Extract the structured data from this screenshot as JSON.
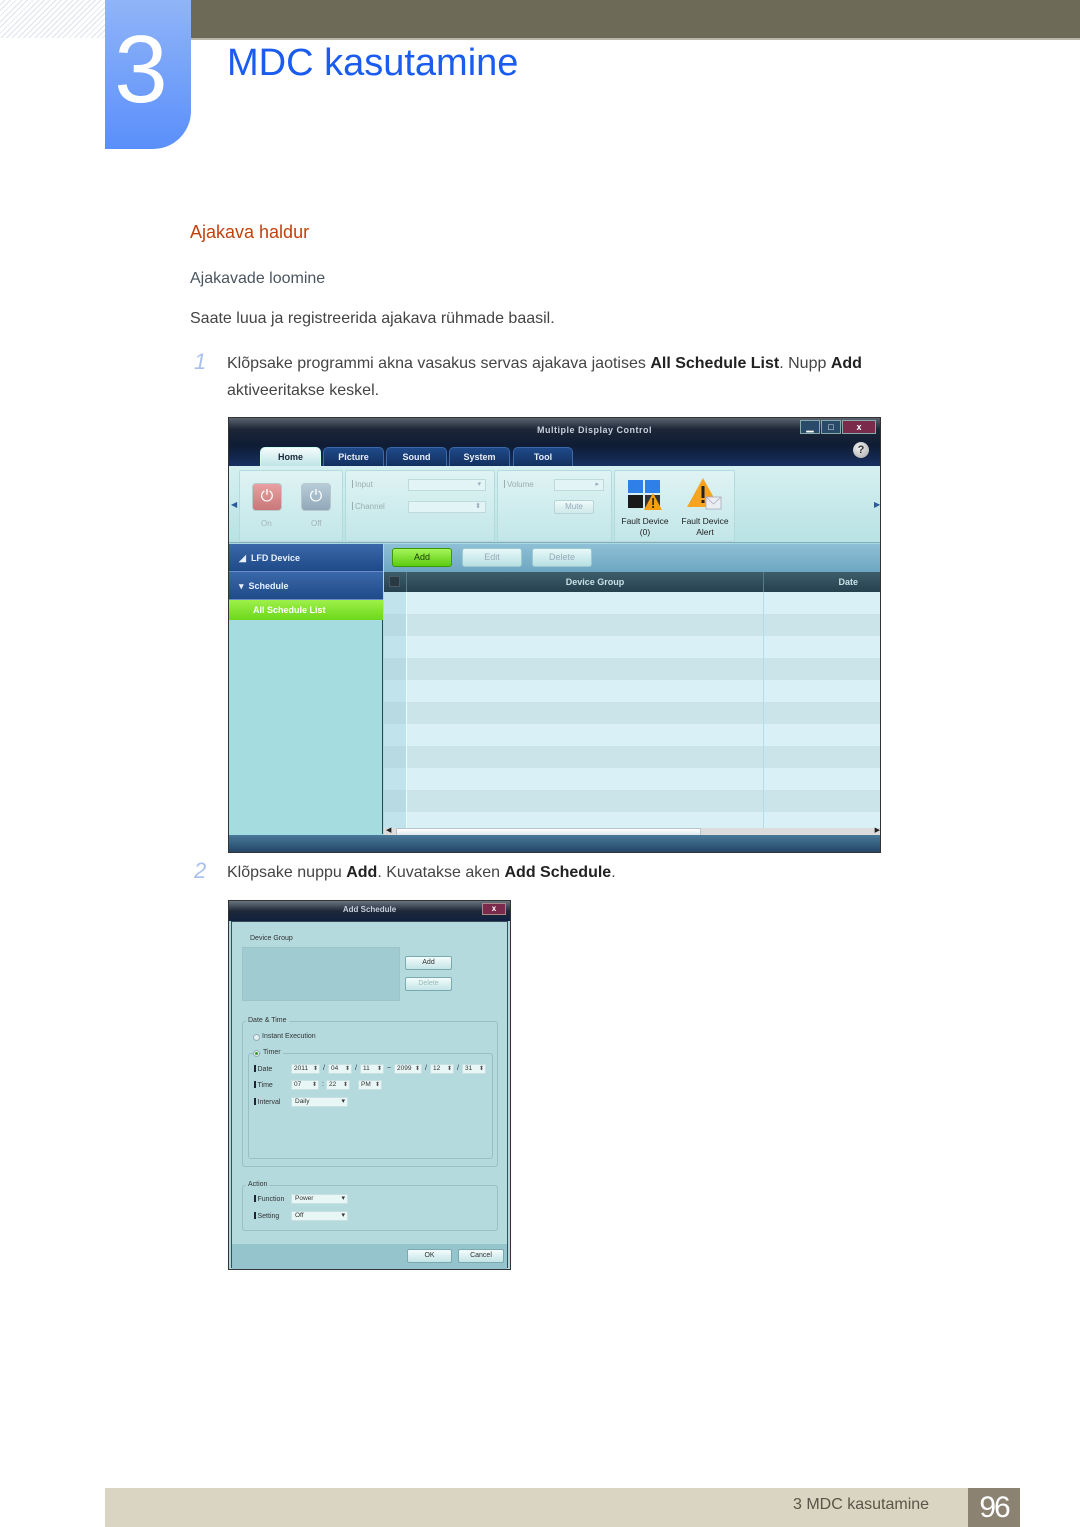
{
  "header": {
    "chapter_number": "3",
    "chapter_title": "MDC kasutamine"
  },
  "section": {
    "title": "Ajakava haldur",
    "subtitle": "Ajakavade loomine",
    "intro": "Saate luua ja registreerida ajakava rühmade baasil."
  },
  "steps": [
    {
      "number": "1",
      "parts": [
        "Klõpsake programmi akna vasakus servas ajakava jaotises ",
        "All Schedule List",
        ". Nupp ",
        "Add",
        " aktiveeritakse keskel."
      ]
    },
    {
      "number": "2",
      "parts": [
        "Klõpsake nuppu ",
        "Add",
        ". Kuvatakse aken ",
        "Add Schedule",
        "."
      ]
    }
  ],
  "mdc_window": {
    "title": "Multiple Display Control",
    "window_buttons": {
      "minimize": "▁",
      "maximize": "□",
      "close": "x"
    },
    "help": "?",
    "tabs": [
      "Home",
      "Picture",
      "Sound",
      "System",
      "Tool"
    ],
    "active_tab": "Home",
    "ribbon": {
      "power_on_label": "On",
      "power_off_label": "Off",
      "input_label": "Input",
      "channel_label": "Channel",
      "volume_label": "Volume",
      "mute_label": "Mute",
      "fault_device_label": "Fault Device",
      "fault_device_count": "(0)",
      "fault_alert_label": "Fault Device",
      "fault_alert_sub": "Alert"
    },
    "sidebar": {
      "items": [
        {
          "label": "LFD Device",
          "icon": "triangle-collapsed-icon"
        },
        {
          "label": "Schedule",
          "icon": "triangle-expanded-icon"
        }
      ],
      "selected": "All Schedule List"
    },
    "toolbar": {
      "add": "Add",
      "edit": "Edit",
      "delete": "Delete"
    },
    "grid": {
      "columns": [
        "Device Group",
        "Date"
      ],
      "row_count": 11
    }
  },
  "add_schedule_dialog": {
    "title": "Add Schedule",
    "close": "x",
    "device_group_label": "Device Group",
    "add_button": "Add",
    "delete_button": "Delete",
    "date_time_legend": "Date & Time",
    "instant_execution": "Instant Execution",
    "timer": "Timer",
    "date_label": "Date",
    "date_from": {
      "year": "2011",
      "month": "04",
      "day": "11"
    },
    "date_to": {
      "year": "2099",
      "month": "12",
      "day": "31"
    },
    "date_sep": "/",
    "range_sep": "~",
    "time_label": "Time",
    "time": {
      "hour": "07",
      "minute": "22",
      "ampm": "PM"
    },
    "time_sep": ":",
    "interval_label": "Interval",
    "interval_value": "Daily",
    "action_legend": "Action",
    "function_label": "Function",
    "function_value": "Power",
    "setting_label": "Setting",
    "setting_value": "Off",
    "ok_button": "OK",
    "cancel_button": "Cancel"
  },
  "footer": {
    "chapter_ref": "3 MDC kasutamine",
    "page_number": "96"
  }
}
